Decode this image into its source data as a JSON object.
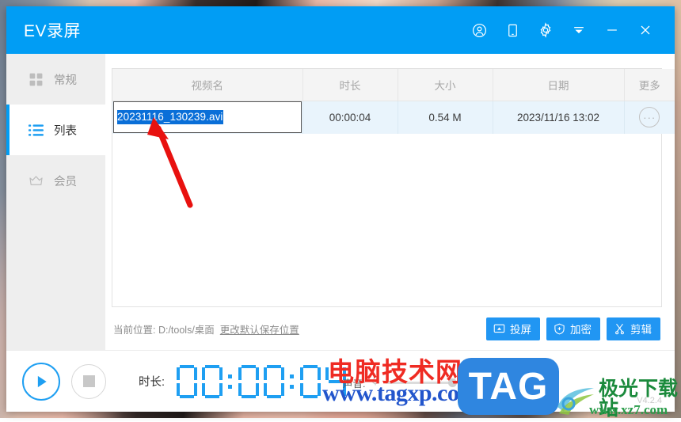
{
  "window": {
    "title": "EV录屏",
    "titlebar_icons": [
      {
        "name": "account-icon",
        "label": "账户"
      },
      {
        "name": "mobile-icon",
        "label": "手机投屏"
      },
      {
        "name": "gear-icon",
        "label": "设置"
      },
      {
        "name": "collapse-icon",
        "label": "收起"
      },
      {
        "name": "minimize-icon",
        "label": "最小化"
      },
      {
        "name": "close-icon",
        "label": "关闭"
      }
    ],
    "version": "V4.2.4"
  },
  "sidebar": {
    "items": [
      {
        "label": "常规",
        "icon": "grid-icon",
        "active": false
      },
      {
        "label": "列表",
        "icon": "list-icon",
        "active": true
      },
      {
        "label": "会员",
        "icon": "crown-icon",
        "active": false
      }
    ]
  },
  "table": {
    "headers": [
      "视频名",
      "时长",
      "大小",
      "日期",
      "更多"
    ],
    "rows": [
      {
        "name": "20231116_130239.avi",
        "name_editing": true,
        "duration": "00:00:04",
        "size": "0.54 M",
        "date": "2023/11/16 13:02",
        "more": "···"
      }
    ]
  },
  "pathbar": {
    "label": "当前位置: D:/tools/桌面",
    "change_link": "更改默认保存位置",
    "buttons": [
      {
        "label": "投屏",
        "icon": "cast-icon"
      },
      {
        "label": "加密",
        "icon": "shield-plus-icon"
      },
      {
        "label": "剪辑",
        "icon": "scissors-icon"
      }
    ]
  },
  "footer": {
    "play_label": "播放",
    "stop_label": "停止",
    "duration_label": "时长:",
    "duration_value": "00:00:04",
    "sound_label": "声音:",
    "volume_percent": 100
  },
  "watermarks": {
    "site_cn": "电脑技术网",
    "site_url": "www.tagxp.com",
    "tag_logo": "TAG",
    "jiguang_cn": "极光下载站",
    "jiguang_url": "www.xz7.com"
  },
  "colors": {
    "accent": "#019df4",
    "button_blue": "#2196f3",
    "row_blue": "#e9f4fc",
    "selection_blue": "#0a6fd8",
    "arrow_red": "#e8110f"
  }
}
